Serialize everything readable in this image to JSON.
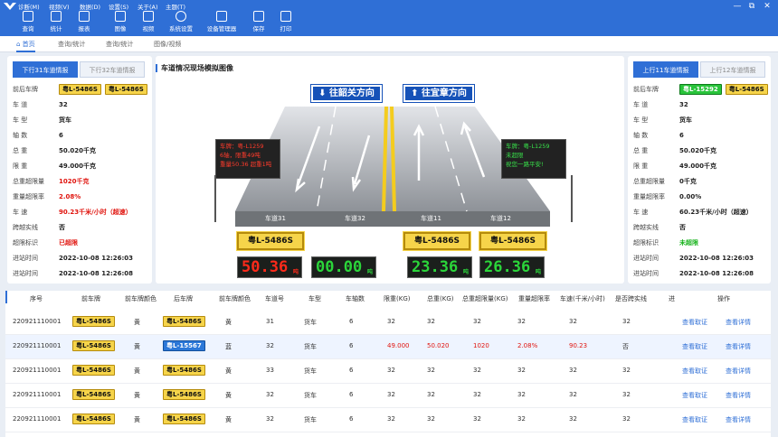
{
  "menu": [
    "诊断(M)",
    "视频(V)",
    "数据(D)",
    "设置(S)",
    "关于(A)",
    "主题(T)"
  ],
  "toolbar": [
    "查询",
    "统计",
    "报表",
    "图像",
    "视频",
    "系统设置",
    "设备管理器",
    "保存",
    "打印"
  ],
  "window_controls": [
    "—",
    "⧉",
    "✕"
  ],
  "tabs": [
    "首页",
    "查询/统计",
    "查询/统计",
    "图像/视频"
  ],
  "left_panel": {
    "tabs": [
      "下行31车道情报",
      "下行32车道情报"
    ],
    "rows": [
      [
        "前后车牌",
        "粤L-5486S"
      ],
      [
        "车 道",
        "32"
      ],
      [
        "车 型",
        "货车"
      ],
      [
        "轴 数",
        "6"
      ],
      [
        "总 重",
        "50.020千克"
      ],
      [
        "限 重",
        "49.000千克"
      ],
      [
        "总重超限量",
        "1020千克"
      ],
      [
        "重量超限率",
        "2.08%"
      ],
      [
        "车 速",
        "90.23千米/小时（超速）"
      ],
      [
        "跨越实线",
        "否"
      ],
      [
        "超限标识",
        "已超限"
      ],
      [
        "进站时间",
        "2022-10-08  12:26:03"
      ],
      [
        "进站时间",
        "2022-10-08  12:26:08"
      ]
    ],
    "plates": [
      "粤L-5486S",
      "粤L-5486S"
    ]
  },
  "right_panel": {
    "tabs": [
      "上行11车道情报",
      "上行12车道情报"
    ],
    "rows": [
      [
        "前后车牌",
        ""
      ],
      [
        "车 道",
        "32"
      ],
      [
        "车 型",
        "货车"
      ],
      [
        "轴 数",
        "6"
      ],
      [
        "总 重",
        "50.020千克"
      ],
      [
        "限 重",
        "49.000千克"
      ],
      [
        "总重超限量",
        "0千克"
      ],
      [
        "重量超限率",
        "0.00%"
      ],
      [
        "车 速",
        "60.23千米/小时（超速）"
      ],
      [
        "跨越实线",
        "否"
      ],
      [
        "超限标识",
        "未超限"
      ],
      [
        "进站时间",
        "2022-10-08  12:26:03"
      ],
      [
        "进站时间",
        "2022-10-08  12:26:08"
      ]
    ],
    "plates": [
      "粤L-15292",
      "粤L-5486S"
    ]
  },
  "scene": {
    "title": "车道情况现场模拟图像",
    "dir_left": "往韶关方向",
    "dir_right": "往宜章方向",
    "lanes": [
      "车道31",
      "车道32",
      "车道11",
      "车道12"
    ],
    "sign_left": [
      "车牌：粤-L1259",
      "6轴，限重49吨",
      "重量50.36 超重1吨"
    ],
    "sign_right": [
      "车牌：粤-L1259",
      "未超限",
      "祝您一路平安!"
    ],
    "plates": [
      "粤L-5486S",
      "粤L-5486S",
      "粤L-5486S"
    ],
    "leds": [
      {
        "v": "50.36",
        "u": "吨",
        "c": "#ff2a1a"
      },
      {
        "v": "00.00",
        "u": "吨",
        "c": "#2bd63a"
      },
      {
        "v": "23.36",
        "u": "吨",
        "c": "#2bd63a"
      },
      {
        "v": "26.36",
        "u": "吨",
        "c": "#2bd63a"
      }
    ]
  },
  "table": {
    "headers": [
      "序号",
      "前车牌",
      "前车牌颜色",
      "后车牌",
      "前车牌颜色",
      "车道号",
      "车型",
      "车轴数",
      "限重(KG)",
      "总重(KG)",
      "总重超限量(KG)",
      "重量超限率",
      "车速(千米/小时)",
      "是否跨实线",
      "进",
      "操作"
    ],
    "rows": [
      [
        "220921110001",
        "粤L-5486S",
        "黄",
        "粤L-5486S",
        "黄",
        "31",
        "货车",
        "6",
        "32",
        "32",
        "32",
        "32",
        "32",
        "32"
      ],
      [
        "220921110001",
        "粤L-5486S",
        "黄",
        "粤L-15567",
        "蓝",
        "32",
        "货车",
        "6",
        "49.000",
        "50.020",
        "1020",
        "2.08%",
        "90.23",
        "否"
      ],
      [
        "220921110001",
        "粤L-5486S",
        "黄",
        "粤L-5486S",
        "黄",
        "33",
        "货车",
        "6",
        "32",
        "32",
        "32",
        "32",
        "32",
        "32"
      ],
      [
        "220921110001",
        "粤L-5486S",
        "黄",
        "粤L-5486S",
        "黄",
        "32",
        "货车",
        "6",
        "32",
        "32",
        "32",
        "32",
        "32",
        "32"
      ],
      [
        "220921110001",
        "粤L-5486S",
        "黄",
        "粤L-5486S",
        "黄",
        "32",
        "货车",
        "6",
        "32",
        "32",
        "32",
        "32",
        "32",
        "32"
      ]
    ],
    "actions": [
      "查看取证",
      "查看详情"
    ]
  }
}
